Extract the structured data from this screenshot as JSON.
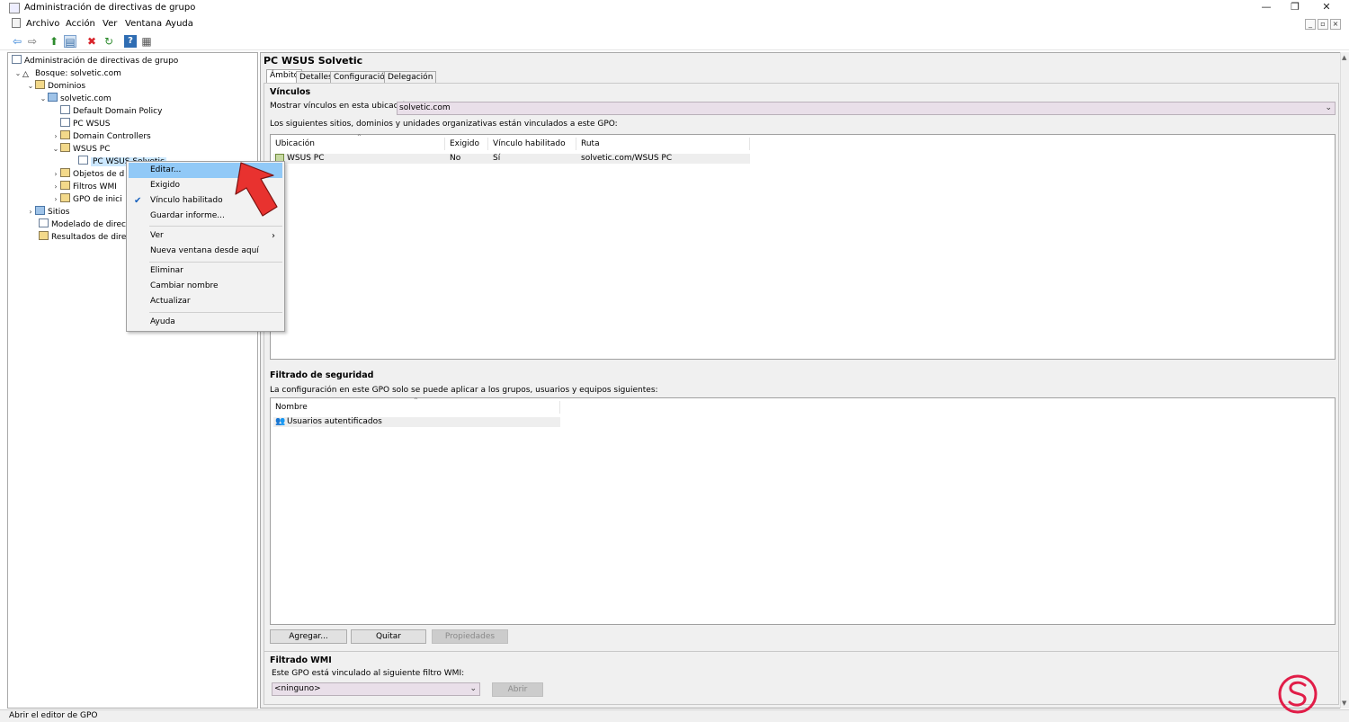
{
  "window": {
    "title": "Administración de directivas de grupo",
    "buttons": [
      "—",
      "❐",
      "✕"
    ],
    "mdi_buttons": [
      "_",
      "▫",
      "×"
    ]
  },
  "menubar": [
    "Archivo",
    "Acción",
    "Ver",
    "Ventana",
    "Ayuda"
  ],
  "toolbar": [
    "back-icon",
    "forward-icon",
    "up-icon",
    "show-hide-tree-icon",
    "delete-icon",
    "refresh-icon",
    "help-icon",
    "properties-icon"
  ],
  "tree": {
    "root": "Administración de directivas de grupo",
    "forest": "Bosque: solvetic.com",
    "domains": "Dominios",
    "domain": "solvetic.com",
    "default_policy": "Default Domain Policy",
    "pc_wsus": "PC WSUS",
    "domain_controllers": "Domain Controllers",
    "wsus_pc": "WSUS PC",
    "pc_wsus_solvetic": "PC WSUS Solvetic",
    "gpo_objects": "Objetos de d",
    "wmi_filters": "Filtros WMI",
    "starter_gpo": "GPO de inici",
    "sites": "Sitios",
    "modeling": "Modelado de directi",
    "results": "Resultados de direct"
  },
  "context_menu": {
    "edit": "Editar...",
    "enforced": "Exigido",
    "link_enabled": "Vínculo habilitado",
    "save_report": "Guardar informe...",
    "view": "Ver",
    "new_window": "Nueva ventana desde aquí",
    "delete": "Eliminar",
    "rename": "Cambiar nombre",
    "refresh": "Actualizar",
    "help": "Ayuda",
    "checkmark": "✔",
    "submenu_arrow": "›"
  },
  "gpo": {
    "title": "PC WSUS Solvetic",
    "tabs": [
      "Ámbito",
      "Detalles",
      "Configuración",
      "Delegación"
    ],
    "links": {
      "heading": "Vínculos",
      "show_links_label": "Mostrar vínculos en esta ubicación:",
      "location_value": "solvetic.com",
      "description": "Los siguientes sitios, dominios y unidades organizativas están vinculados a este GPO:",
      "columns": [
        "Ubicación",
        "Exigido",
        "Vínculo habilitado",
        "Ruta"
      ],
      "rows": [
        [
          "WSUS PC",
          "No",
          "Sí",
          "solvetic.com/WSUS PC"
        ]
      ]
    },
    "security": {
      "heading": "Filtrado de seguridad",
      "description": "La configuración en este GPO solo se puede aplicar a los grupos, usuarios y equipos siguientes:",
      "columns": [
        "Nombre"
      ],
      "rows": [
        "Usuarios autentificados"
      ],
      "add_button": "Agregar...",
      "remove_button": "Quitar",
      "properties_button": "Propiedades"
    },
    "wmi": {
      "heading": "Filtrado WMI",
      "description": "Este GPO está vinculado al siguiente filtro WMI:",
      "filter_value": "<ninguno>",
      "open_button": "Abrir"
    }
  },
  "statusbar": "Abrir el editor de GPO",
  "colors": {
    "menu_highlight": "#91c9f7",
    "arrow_fill": "#e8322f",
    "combo_bg": "#e9dfe9"
  }
}
